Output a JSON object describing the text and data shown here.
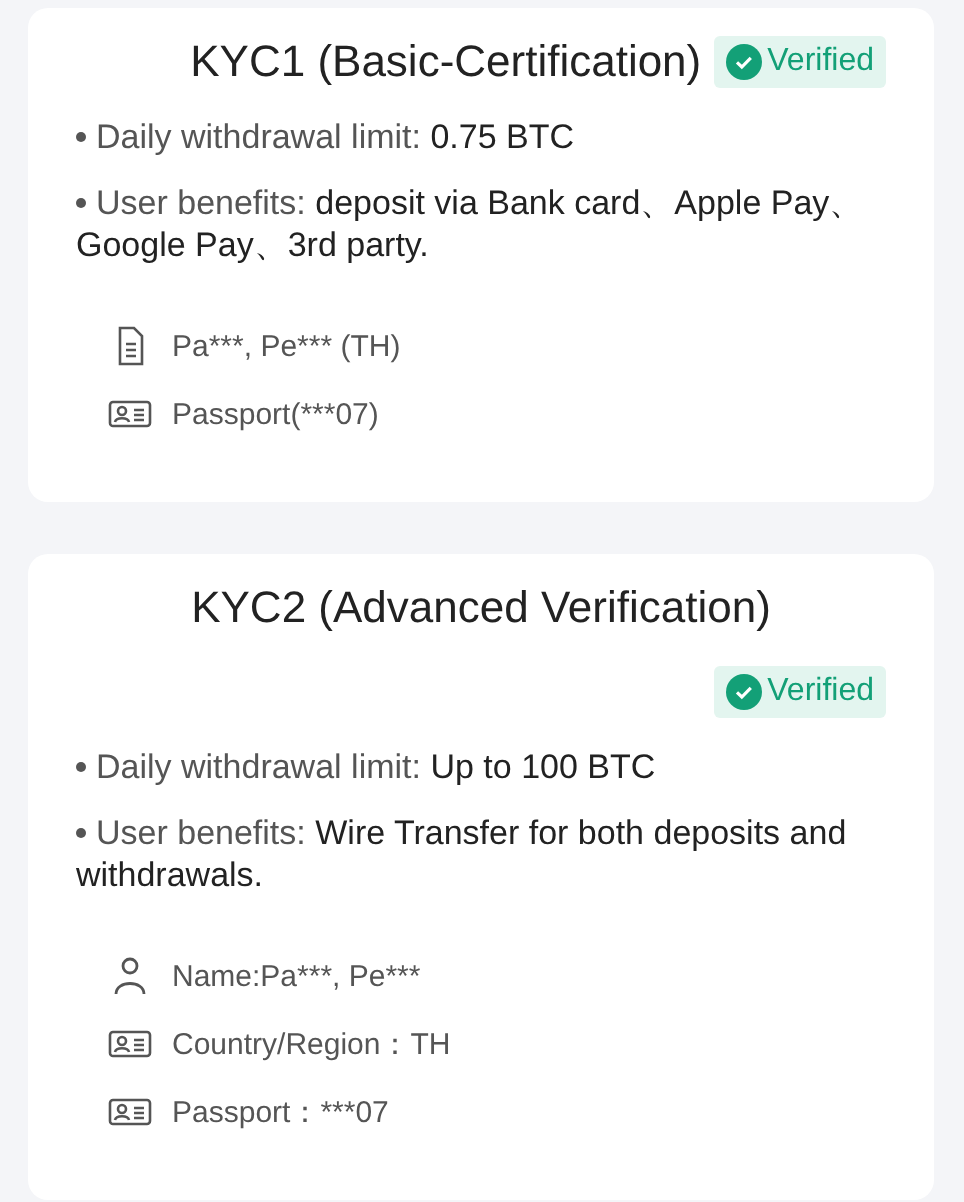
{
  "cards": [
    {
      "title": "KYC1 (Basic-Certification)",
      "badge": {
        "label": "Verified",
        "kind": "inline"
      },
      "bullets": [
        {
          "label": "Daily withdrawal limit:",
          "value": "0.75 BTC"
        },
        {
          "label": "User benefits:",
          "value": "deposit via Bank card、Apple Pay、Google Pay、3rd party."
        }
      ],
      "details": [
        {
          "kind": "document",
          "text": "Pa***, Pe*** (TH)"
        },
        {
          "kind": "id-card",
          "text": "Passport(***07)"
        }
      ]
    },
    {
      "title": "KYC2 (Advanced Verification)",
      "badge": {
        "label": "Verified",
        "kind": "below"
      },
      "bullets": [
        {
          "label": "Daily withdrawal limit:",
          "value": "Up to 100 BTC"
        },
        {
          "label": "User benefits:",
          "value": "Wire Transfer for both deposits and withdrawals."
        }
      ],
      "details": [
        {
          "kind": "person",
          "text": "Name:Pa***, Pe***"
        },
        {
          "kind": "id-card",
          "text": "Country/Region：TH"
        },
        {
          "kind": "id-card",
          "text": "Passport：***07"
        }
      ]
    }
  ]
}
